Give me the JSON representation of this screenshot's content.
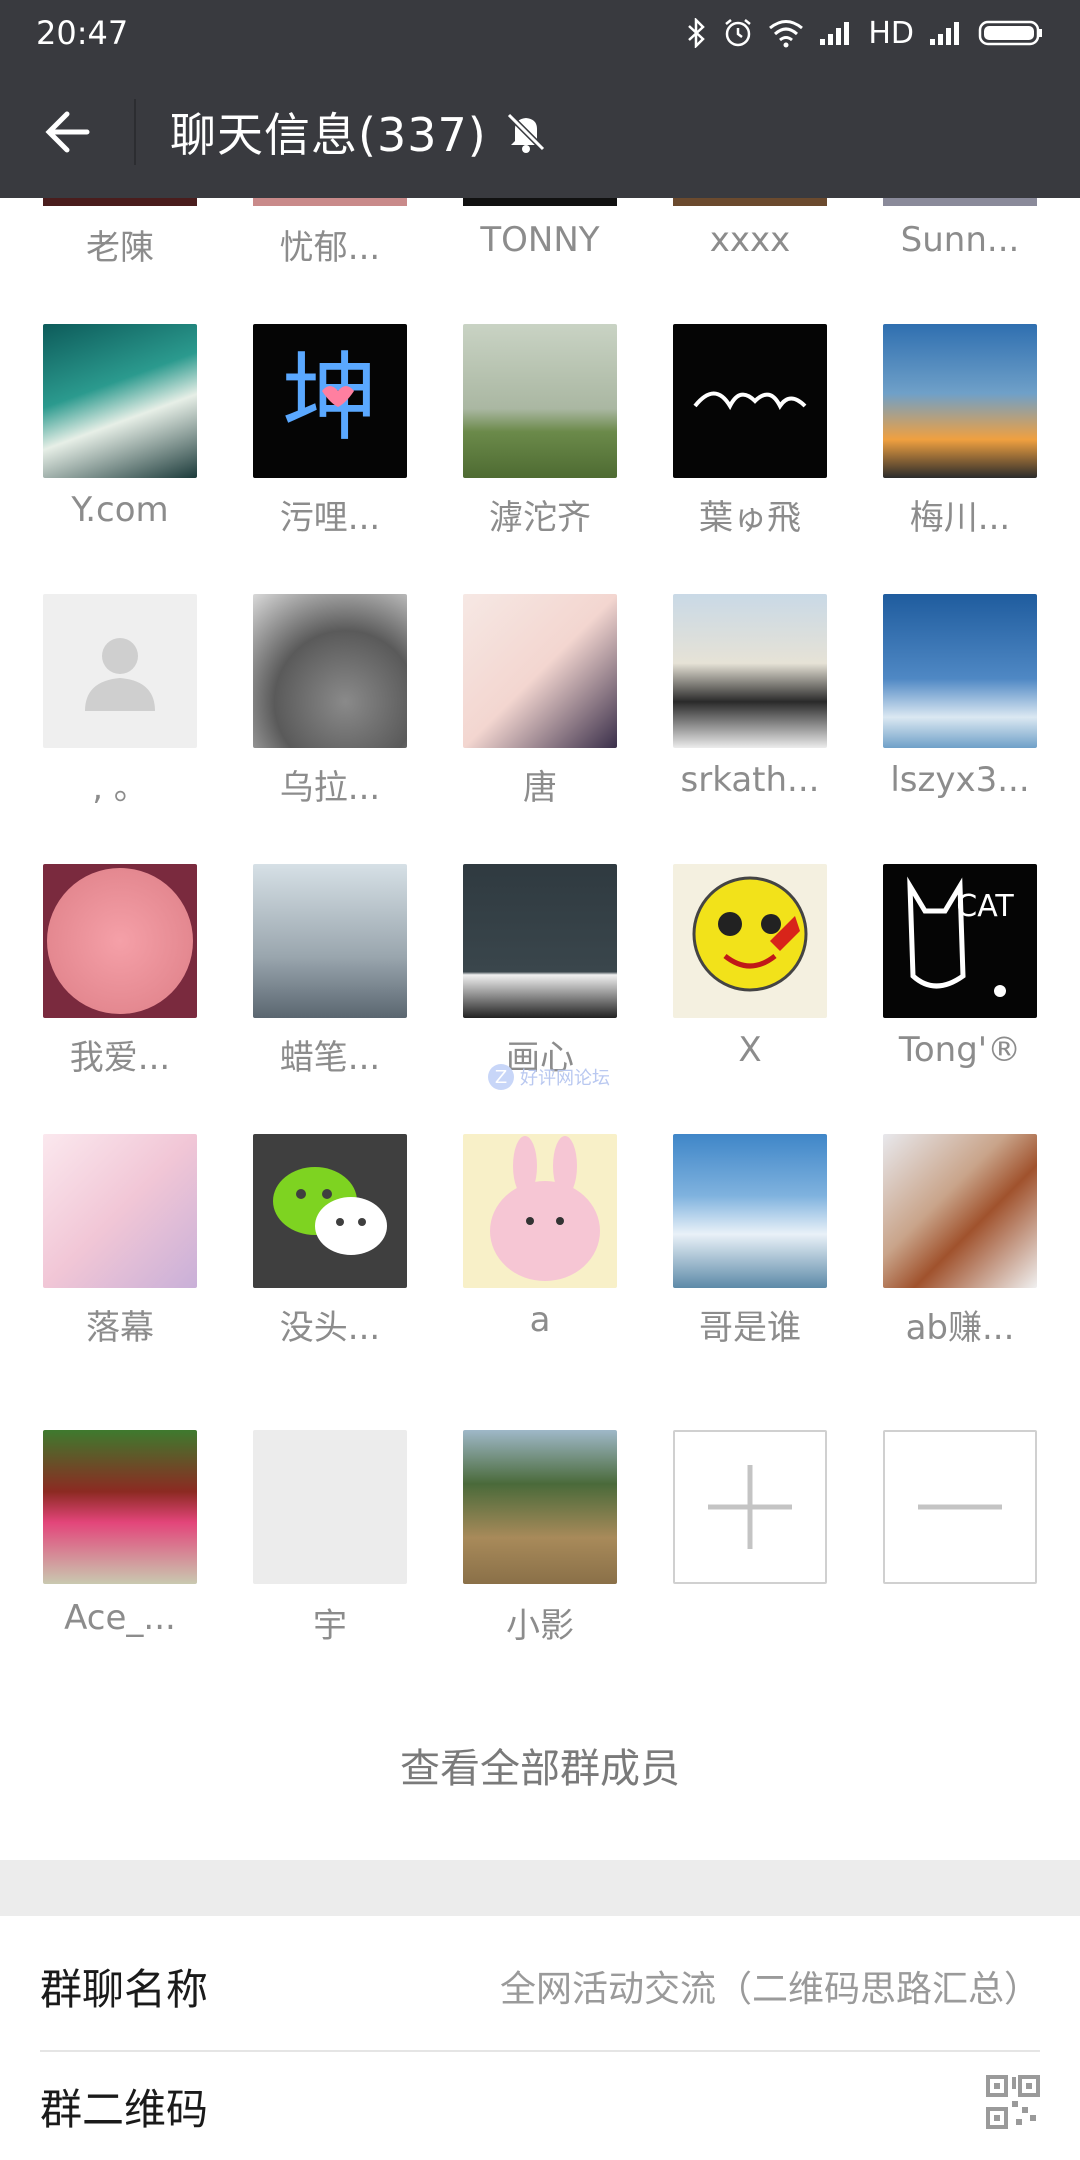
{
  "status_bar": {
    "time": "20:47",
    "network_label": "HD"
  },
  "header": {
    "title": "聊天信息(337)",
    "back_icon": "arrow-left-icon",
    "mute_icon": "bell-off-icon"
  },
  "members": {
    "row1": [
      "老陳",
      "忧郁...",
      "TONNY",
      "xxxx",
      "Sunn..."
    ],
    "row2": [
      "Y.com",
      "污哩...",
      "滹沱齐",
      "葉ゅ飛",
      "梅川..."
    ],
    "row3": [
      ", 。",
      "乌拉...",
      "唐",
      "srkath...",
      "lszyx3..."
    ],
    "row4": [
      "我爱...",
      "蜡笔...",
      "画心",
      "X",
      "Tong'®"
    ],
    "row5": [
      "落幕",
      "没头...",
      "a",
      "哥是谁",
      "ab赚..."
    ],
    "row6": [
      "Ace_...",
      "宇",
      "小影"
    ]
  },
  "controls": {
    "add_icon": "plus-icon",
    "remove_icon": "minus-icon"
  },
  "view_all": "查看全部群成员",
  "settings": {
    "group_name_label": "群聊名称",
    "group_name_value": "全网活动交流（二维码思路汇总）",
    "qr_label": "群二维码",
    "qr_icon": "qr-code-icon"
  },
  "watermark": {
    "text": "好评网论坛"
  }
}
